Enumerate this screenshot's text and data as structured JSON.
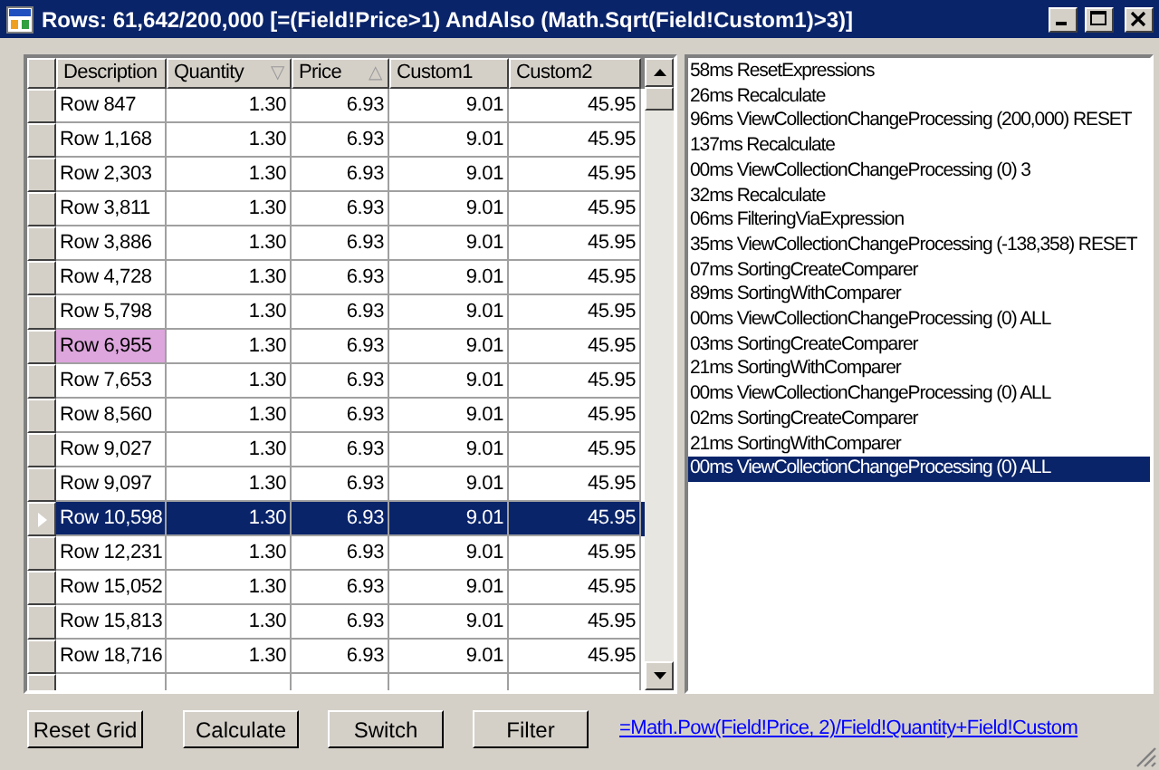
{
  "window": {
    "title": "Rows: 61,642/200,000 [=(Field!Price>1) AndAlso (Math.Sqrt(Field!Custom1)>3)]"
  },
  "grid": {
    "columns": [
      {
        "label": "Description"
      },
      {
        "label": "Quantity",
        "sort_glyph": "▽"
      },
      {
        "label": "Price",
        "sort_glyph": "△"
      },
      {
        "label": "Custom1"
      },
      {
        "label": "Custom2"
      }
    ],
    "rows": [
      {
        "cells": [
          "Row 847",
          "1.30",
          "6.93",
          "9.01",
          "45.95"
        ],
        "selected": false
      },
      {
        "cells": [
          "Row 1,168",
          "1.30",
          "6.93",
          "9.01",
          "45.95"
        ],
        "selected": false
      },
      {
        "cells": [
          "Row 2,303",
          "1.30",
          "6.93",
          "9.01",
          "45.95"
        ],
        "selected": false
      },
      {
        "cells": [
          "Row 3,811",
          "1.30",
          "6.93",
          "9.01",
          "45.95"
        ],
        "selected": false
      },
      {
        "cells": [
          "Row 3,886",
          "1.30",
          "6.93",
          "9.01",
          "45.95"
        ],
        "selected": false
      },
      {
        "cells": [
          "Row 4,728",
          "1.30",
          "6.93",
          "9.01",
          "45.95"
        ],
        "selected": false
      },
      {
        "cells": [
          "Row 5,798",
          "1.30",
          "6.93",
          "9.01",
          "45.95"
        ],
        "selected": false
      },
      {
        "cells": [
          "Row 6,955",
          "1.30",
          "6.93",
          "9.01",
          "45.95"
        ],
        "selected": false,
        "color": "#dda6dd"
      },
      {
        "cells": [
          "Row 7,653",
          "1.30",
          "6.93",
          "9.01",
          "45.95"
        ],
        "selected": false
      },
      {
        "cells": [
          "Row 8,560",
          "1.30",
          "6.93",
          "9.01",
          "45.95"
        ],
        "selected": false
      },
      {
        "cells": [
          "Row 9,027",
          "1.30",
          "6.93",
          "9.01",
          "45.95"
        ],
        "selected": false
      },
      {
        "cells": [
          "Row 9,097",
          "1.30",
          "6.93",
          "9.01",
          "45.95"
        ],
        "selected": false
      },
      {
        "cells": [
          "Row 10,598",
          "1.30",
          "6.93",
          "9.01",
          "45.95"
        ],
        "selected": true
      },
      {
        "cells": [
          "Row 12,231",
          "1.30",
          "6.93",
          "9.01",
          "45.95"
        ],
        "selected": false
      },
      {
        "cells": [
          "Row 15,052",
          "1.30",
          "6.93",
          "9.01",
          "45.95"
        ],
        "selected": false
      },
      {
        "cells": [
          "Row 15,813",
          "1.30",
          "6.93",
          "9.01",
          "45.95"
        ],
        "selected": false
      },
      {
        "cells": [
          "Row 18,716",
          "1.30",
          "6.93",
          "9.01",
          "45.95"
        ],
        "selected": false
      }
    ]
  },
  "log": [
    {
      "text": "58ms ResetExpressions",
      "selected": false
    },
    {
      "text": "26ms Recalculate",
      "selected": false
    },
    {
      "text": "96ms ViewCollectionChangeProcessing (200,000) RESET",
      "selected": false
    },
    {
      "text": "137ms Recalculate",
      "selected": false
    },
    {
      "text": "00ms ViewCollectionChangeProcessing (0) 3",
      "selected": false
    },
    {
      "text": "32ms Recalculate",
      "selected": false
    },
    {
      "text": "06ms FilteringViaExpression",
      "selected": false
    },
    {
      "text": "35ms ViewCollectionChangeProcessing (-138,358) RESET",
      "selected": false
    },
    {
      "text": "07ms SortingCreateComparer",
      "selected": false
    },
    {
      "text": "89ms SortingWithComparer",
      "selected": false
    },
    {
      "text": "00ms ViewCollectionChangeProcessing (0) ALL",
      "selected": false
    },
    {
      "text": "03ms SortingCreateComparer",
      "selected": false
    },
    {
      "text": "21ms SortingWithComparer",
      "selected": false
    },
    {
      "text": "00ms ViewCollectionChangeProcessing (0) ALL",
      "selected": false
    },
    {
      "text": "02ms SortingCreateComparer",
      "selected": false
    },
    {
      "text": "21ms SortingWithComparer",
      "selected": false
    },
    {
      "text": "00ms ViewCollectionChangeProcessing (0) ALL",
      "selected": true
    }
  ],
  "buttons": [
    "Reset Grid",
    "Calculate",
    "Switch",
    "Filter"
  ],
  "link": "=Math.Pow(Field!Price, 2)/Field!Quantity+Field!Custom"
}
